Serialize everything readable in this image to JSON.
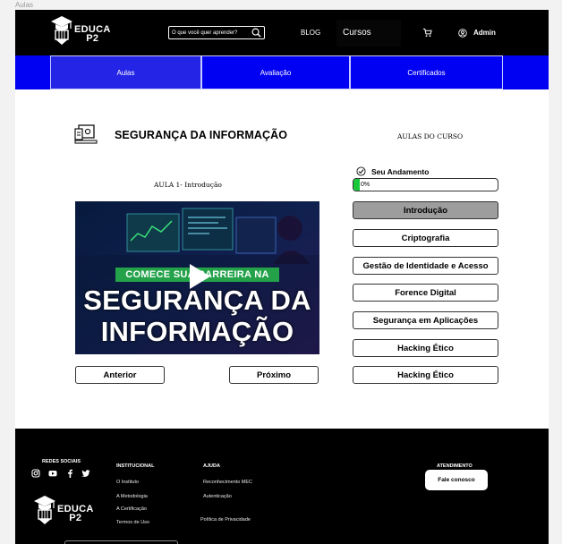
{
  "frame_label": "Aulas",
  "header": {
    "logo_text_1": "EDUCA",
    "logo_text_2": "P2",
    "search_placeholder": "O que você quer aprender?",
    "nav_blog": "BLOG",
    "nav_cursos": "Cursos",
    "user_name": "Admin",
    "icons": [
      "graduation-cap-pencil-logo",
      "search-icon",
      "cart-icon",
      "user-icon"
    ]
  },
  "tabs": [
    {
      "label": "Aulas",
      "active": true
    },
    {
      "label": "Avaliação",
      "active": false
    },
    {
      "label": "Certificados",
      "active": false
    }
  ],
  "course": {
    "title": "SEGURANÇA DA INFORMAÇÃO",
    "lesson_title": "AULA 1- Introdução",
    "video": {
      "banner": "COMECE SUA CARREIRA NA",
      "line1": "SEGURANÇA DA",
      "line2": "INFORMAÇÃO"
    },
    "prev_label": "Anterior",
    "next_label": "Próximo"
  },
  "sidebar": {
    "heading": "AULAS DO CURSO",
    "progress_label": "Seu Andamento",
    "progress_value": 0,
    "progress_text": "0%",
    "lessons": [
      {
        "label": "Introdução",
        "active": true
      },
      {
        "label": "Criptografia",
        "active": false
      },
      {
        "label": "Gestão de Identidade e Acesso",
        "active": false
      },
      {
        "label": "Forence Digital",
        "active": false
      },
      {
        "label": "Segurança em Aplicações",
        "active": false
      },
      {
        "label": "Hacking Ético",
        "active": false
      },
      {
        "label": "Hacking Ético",
        "active": false
      }
    ],
    "accent_color": "#19c93a"
  },
  "footer": {
    "social_heading": "REDES SOCIAIS",
    "institutional_heading": "INSTITUCIONAL",
    "institutional_links": [
      "O Instituto",
      "A Metodologia",
      "A Certificação",
      "Termos de Uso"
    ],
    "help_heading": "AJUDA",
    "help_links": [
      "Reconhecimento MEC",
      "Autenticação",
      "Política de Privacidade"
    ],
    "support_heading": "ATENDIMENTO",
    "contact_button": "Fale conosco",
    "logo_text_1": "EDUCA",
    "logo_text_2": "P2"
  },
  "colors": {
    "tabs_bg": "#0000f2",
    "header_bg": "#000000",
    "footer_bg": "#000000"
  }
}
